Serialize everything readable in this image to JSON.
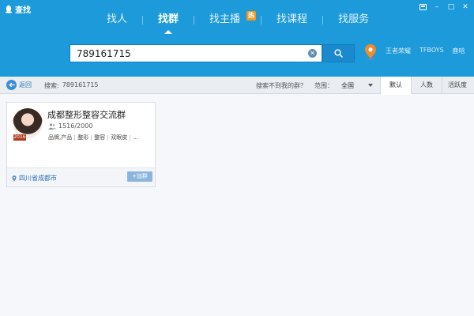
{
  "window": {
    "title": "查找",
    "controls": {
      "skin_icon": "skin-icon",
      "minimize": "–",
      "maximize": "□",
      "close": "✕"
    }
  },
  "nav": {
    "items": [
      {
        "label": "找人",
        "active": false
      },
      {
        "label": "找群",
        "active": true
      },
      {
        "label": "找主播",
        "active": false,
        "badge": "热"
      },
      {
        "label": "找课程",
        "active": false
      },
      {
        "label": "找服务",
        "active": false
      }
    ]
  },
  "search": {
    "value": "789161715",
    "clear_icon": "clear-icon",
    "search_icon": "magnifier-icon"
  },
  "hot_words": [
    "王者荣耀",
    "TFBOYS",
    "鹿晗"
  ],
  "toolbar": {
    "back_label": "返回",
    "summary_prefix": "搜索:",
    "summary_value": "789161715",
    "not_found": "搜索不到我的群？",
    "scope_label": "范围：",
    "scope_value": "全国",
    "sort_tabs": [
      {
        "label": "默认",
        "active": true
      },
      {
        "label": "人数",
        "active": false
      },
      {
        "label": "活跃度",
        "active": false
      }
    ]
  },
  "result": {
    "name": "成都整形整容交流群",
    "badge": "2016",
    "members": "1516/2000",
    "tags": [
      "品牌,产品",
      "整形",
      "整容",
      "双眼皮",
      "..."
    ],
    "location": "四川省成都市",
    "join_label": "+加群"
  },
  "colors": {
    "header": "#1c9ad9",
    "accent": "#1a8acd",
    "join_button": "#8ab6de",
    "link": "#2a72b5"
  }
}
